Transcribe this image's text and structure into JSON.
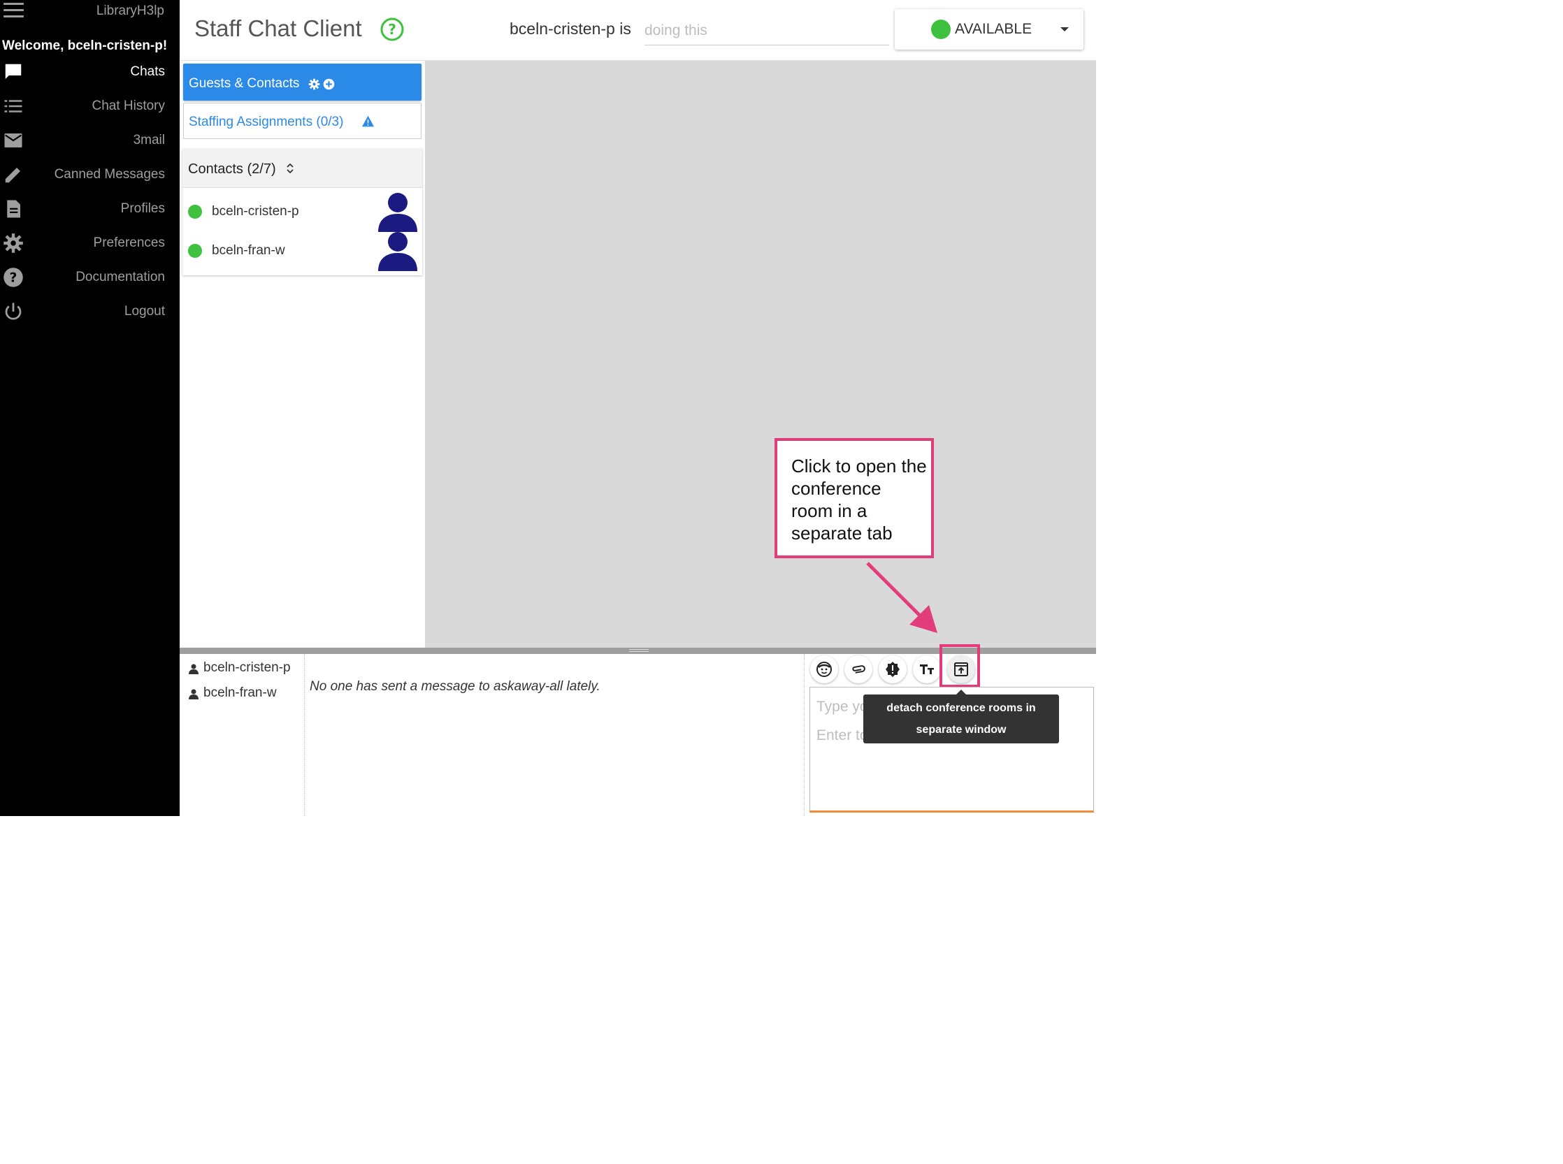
{
  "sidebar": {
    "brand": "LibraryH3lp",
    "welcome": "Welcome, bceln-cristen-p!",
    "items": [
      {
        "label": "Chats",
        "icon": "chat-bubble-icon",
        "active": true
      },
      {
        "label": "Chat History",
        "icon": "list-icon"
      },
      {
        "label": "3mail",
        "icon": "mail-icon"
      },
      {
        "label": "Canned Messages",
        "icon": "pencil-icon"
      },
      {
        "label": "Profiles",
        "icon": "document-icon"
      },
      {
        "label": "Preferences",
        "icon": "gear-icon"
      },
      {
        "label": "Documentation",
        "icon": "help-circle-icon"
      },
      {
        "label": "Logout",
        "icon": "power-icon"
      }
    ]
  },
  "header": {
    "title": "Staff Chat Client",
    "status_prefix": "bceln-cristen-p is",
    "status_placeholder": "doing this",
    "availability": "AVAILABLE"
  },
  "panel": {
    "guests_label": "Guests & Contacts",
    "staffing_label": "Staffing Assignments (0/3)",
    "contacts_header": "Contacts (2/7)",
    "contacts": [
      {
        "name": "bceln-cristen-p",
        "status": "online"
      },
      {
        "name": "bceln-fran-w",
        "status": "online"
      }
    ]
  },
  "callout": {
    "text": "Click to open the conference room in a separate tab"
  },
  "conversation": {
    "participants": [
      "bceln-cristen-p",
      "bceln-fran-w"
    ],
    "empty_message": "No one has sent a message to askaway-all lately.",
    "input_placeholder_1": "Type yo",
    "input_placeholder_2": "Enter to",
    "tooltip_line1": "detach conference rooms in",
    "tooltip_line2": "separate window"
  },
  "colors": {
    "accent_blue": "#2b8ae8",
    "online_green": "#3ec13e",
    "highlight_pink": "#e23d7a",
    "avatar_navy": "#1a1a80"
  }
}
